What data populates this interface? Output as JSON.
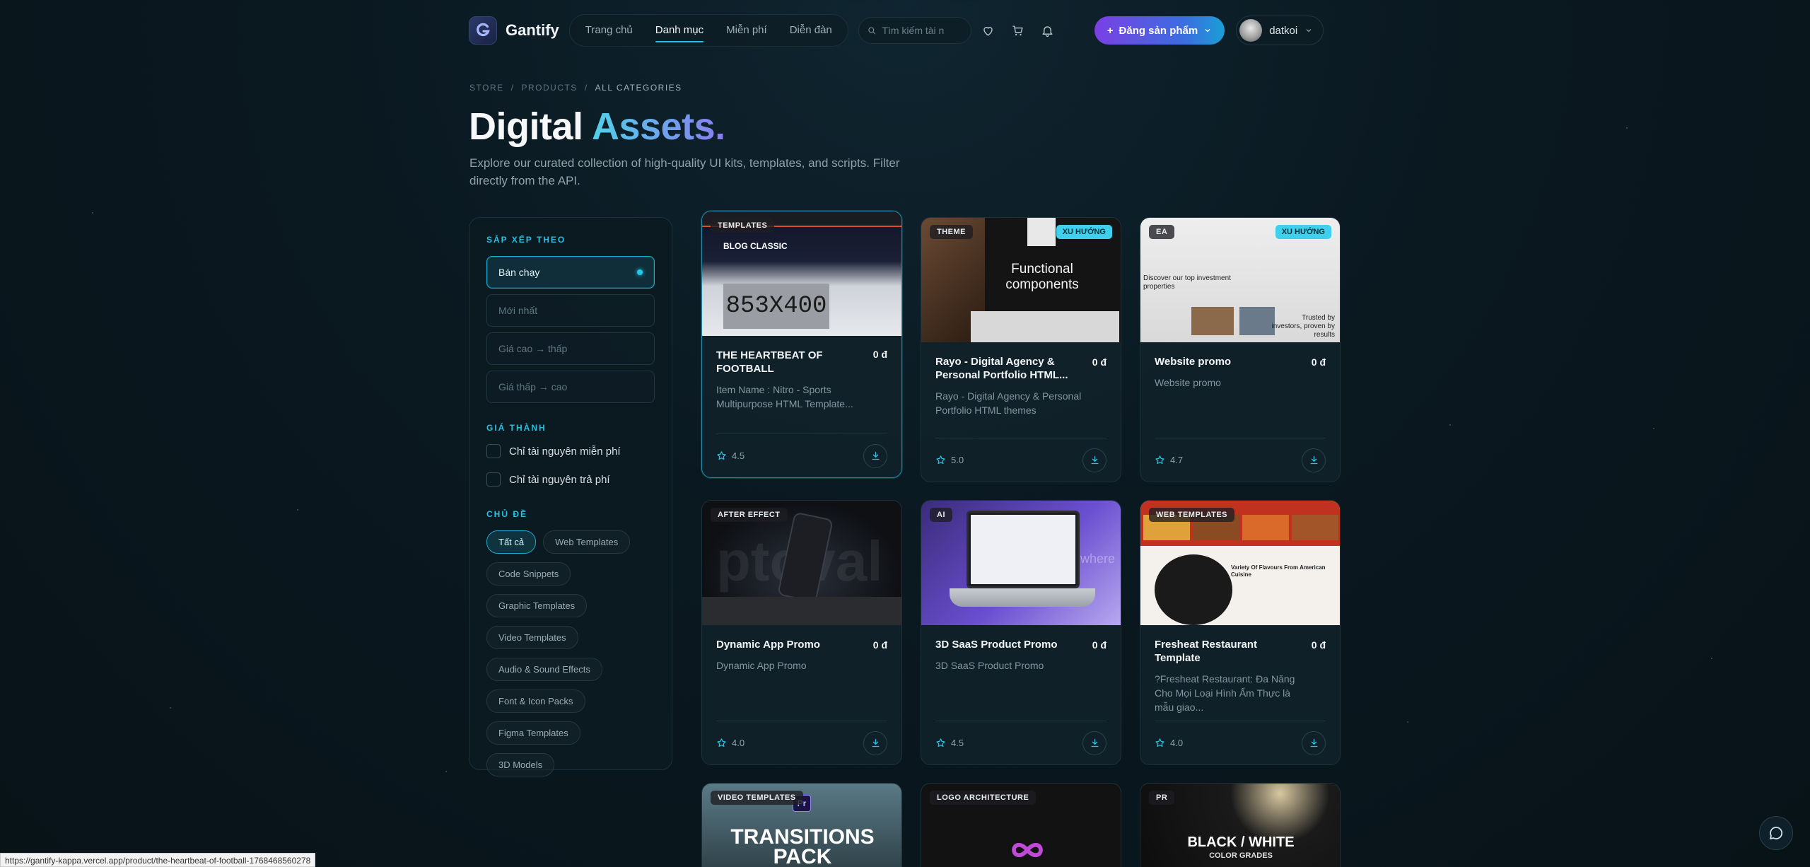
{
  "header": {
    "brand": "Gantify",
    "nav": [
      "Trang chủ",
      "Danh mục",
      "Miễn phí",
      "Diễn đàn"
    ],
    "active_nav": "Danh mục",
    "search_placeholder": "Tìm kiếm tài n",
    "post_label": "Đăng sản phẩm",
    "user_name": "datkoi"
  },
  "breadcrumb": [
    "STORE",
    "PRODUCTS",
    "ALL CATEGORIES"
  ],
  "hero": {
    "title_main": "Digital",
    "title_accent": "Assets.",
    "subtitle": "Explore our curated collection of high-quality UI kits, templates, and scripts. Filter directly from the API."
  },
  "sidebar": {
    "sort_title": "SẮP XẾP THEO",
    "sort_options": [
      "Bán chạy",
      "Mới nhất",
      "Giá cao → thấp",
      "Giá thấp → cao"
    ],
    "price_title": "GIÁ THÀNH",
    "price_options": [
      "Chỉ tài nguyên miễn phí",
      "Chỉ tài nguyên trả phí"
    ],
    "topic_title": "CHỦ ĐỀ",
    "topics": [
      "Tất cả",
      "Web Templates",
      "Code Snippets",
      "Graphic Templates",
      "Video Templates",
      "Audio & Sound Effects",
      "Font & Icon Packs",
      "Figma Templates",
      "3D Models"
    ]
  },
  "products": [
    {
      "badge": "TEMPLATES",
      "trend": "",
      "name": "THE HEARTBEAT OF FOOTBALL",
      "price": "0 đ",
      "desc": "Item Name : Nitro - Sports Multipurpose HTML Template...",
      "rating": "4.5",
      "thumb_text": "853X400",
      "thumb_sub": "BLOG CLASSIC"
    },
    {
      "badge": "THEME",
      "trend": "XU HƯỚNG",
      "name": "Rayo - Digital Agency & Personal Portfolio HTML...",
      "price": "0 đ",
      "desc": "Rayo - Digital Agency & Personal Portfolio HTML themes",
      "rating": "5.0",
      "thumb_text": "Functional components",
      "thumb_sub": ""
    },
    {
      "badge": "EA",
      "trend": "XU HƯỚNG",
      "name": "Website promo",
      "price": "0 đ",
      "desc": "Website promo",
      "rating": "4.7",
      "thumb_text": "Discover our top investment properties",
      "thumb_sub": "Trusted by investors, proven by results"
    },
    {
      "badge": "AFTER EFFECT",
      "trend": "",
      "name": "Dynamic App Promo",
      "price": "0 đ",
      "desc": "Dynamic App Promo",
      "rating": "4.0",
      "thumb_text": "ptoval",
      "thumb_sub": ""
    },
    {
      "badge": "AI",
      "trend": "",
      "name": "3D SaaS Product Promo",
      "price": "0 đ",
      "desc": "3D SaaS Product Promo",
      "rating": "4.5",
      "thumb_text": "where",
      "thumb_sub": ""
    },
    {
      "badge": "WEB TEMPLATES",
      "trend": "",
      "name": "Fresheat Restaurant Template",
      "price": "0 đ",
      "desc": "?Fresheat Restaurant: Đa Năng Cho Mọi Loại Hình Ẩm Thực là mẫu giao...",
      "rating": "4.0",
      "thumb_text": "Variety Of Flavours From American Cuisine",
      "thumb_sub": ""
    },
    {
      "badge": "VIDEO TEMPLATES",
      "trend": "",
      "name": "",
      "price": "",
      "desc": "",
      "rating": "",
      "thumb_text": "TRANSITIONS PACK",
      "thumb_sub": "Pr"
    },
    {
      "badge": "LOGO ARCHITECTURE",
      "trend": "",
      "name": "",
      "price": "",
      "desc": "",
      "rating": "",
      "thumb_text": "",
      "thumb_sub": ""
    },
    {
      "badge": "PR",
      "trend": "",
      "name": "",
      "price": "",
      "desc": "",
      "rating": "",
      "thumb_text": "BLACK / WHITE",
      "thumb_sub": "COLOR GRADES"
    }
  ],
  "status_url": "https://gantify-kappa.vercel.app/product/the-heartbeat-of-football-1768468560278",
  "colors": {
    "accent": "#22c3e6",
    "trend_badge": "#3ed0ec",
    "post_button_start": "#7b3fe4"
  }
}
